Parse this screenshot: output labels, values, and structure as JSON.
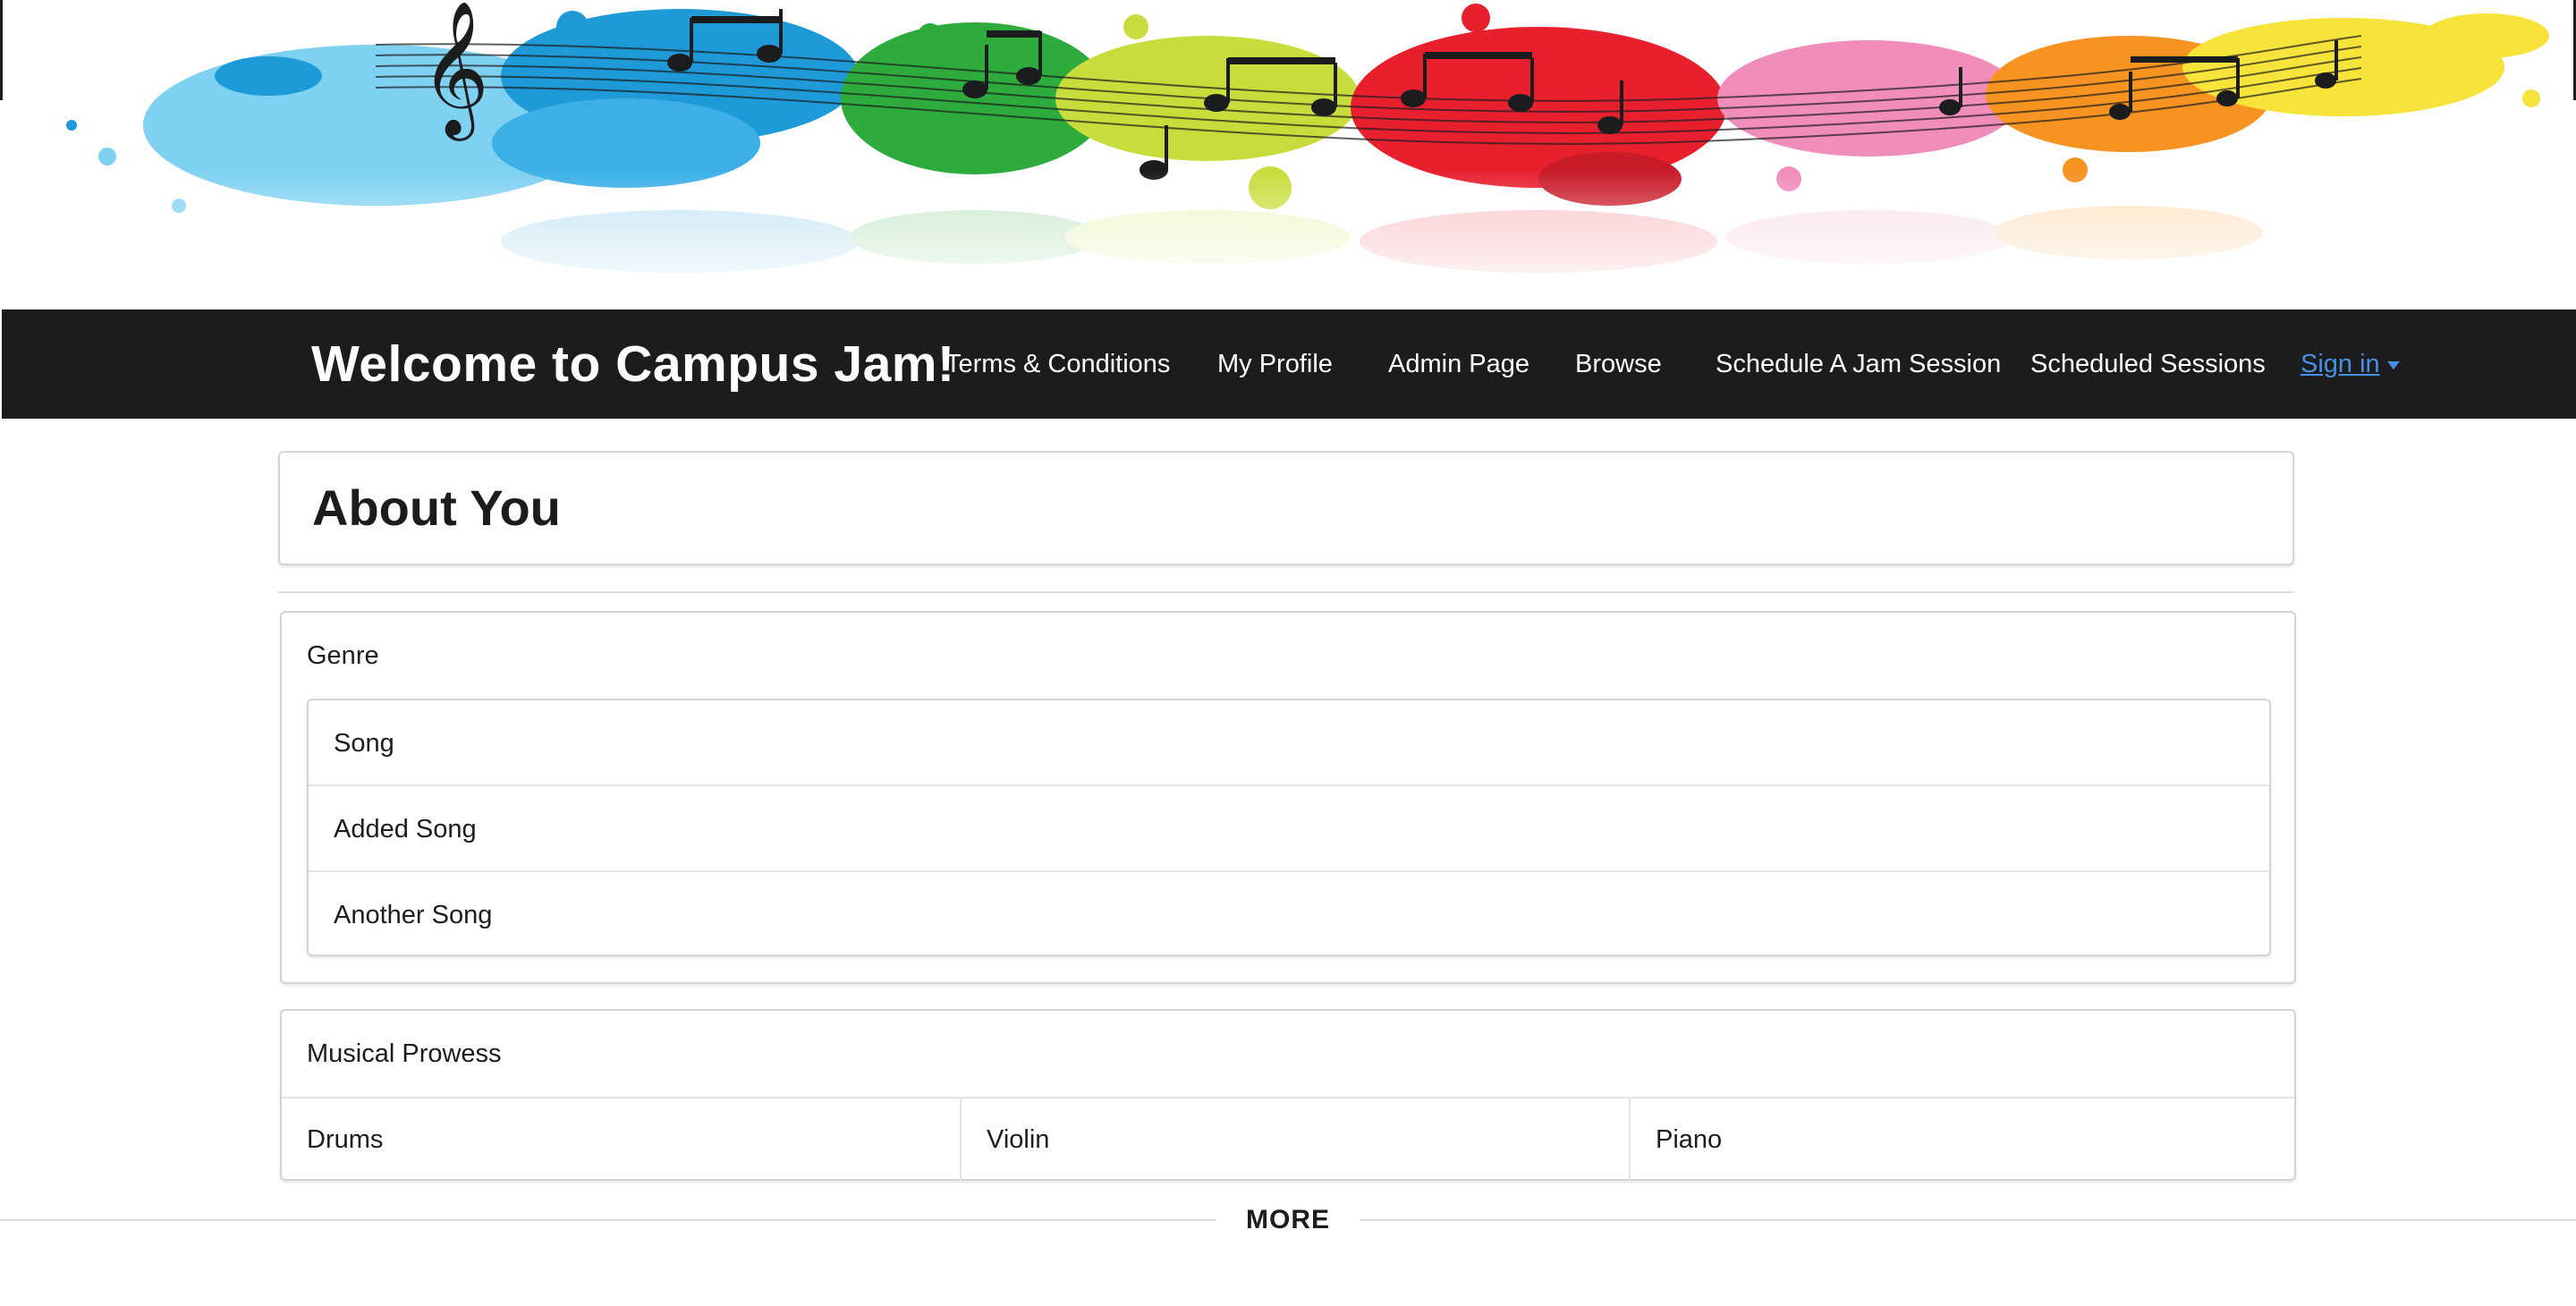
{
  "banner": {
    "icon": "paint-splash-music-notes-banner",
    "colors": [
      "#1f9ad8",
      "#2dab3c",
      "#c8dc3c",
      "#e8202e",
      "#f08dbb",
      "#f79320",
      "#f7e33a"
    ]
  },
  "navbar": {
    "brand": "Welcome to Campus Jam!",
    "items": [
      {
        "label": "Terms & Conditions"
      },
      {
        "label": "My Profile"
      },
      {
        "label": "Admin Page"
      },
      {
        "label": "Browse"
      },
      {
        "label": "Schedule A Jam Session"
      },
      {
        "label": "Scheduled Sessions"
      }
    ],
    "signin": {
      "label": "Sign in",
      "icon": "caret-down-icon",
      "color": "#4a90e2"
    },
    "background": "#1b1c1d"
  },
  "main": {
    "title": "About You",
    "genre": {
      "header": "Genre",
      "songs": [
        "Song",
        "Added Song",
        "Another Song"
      ]
    },
    "prowess": {
      "header": "Musical Prowess",
      "instruments": [
        "Drums",
        "Violin",
        "Piano"
      ]
    },
    "more_label": "MORE"
  }
}
